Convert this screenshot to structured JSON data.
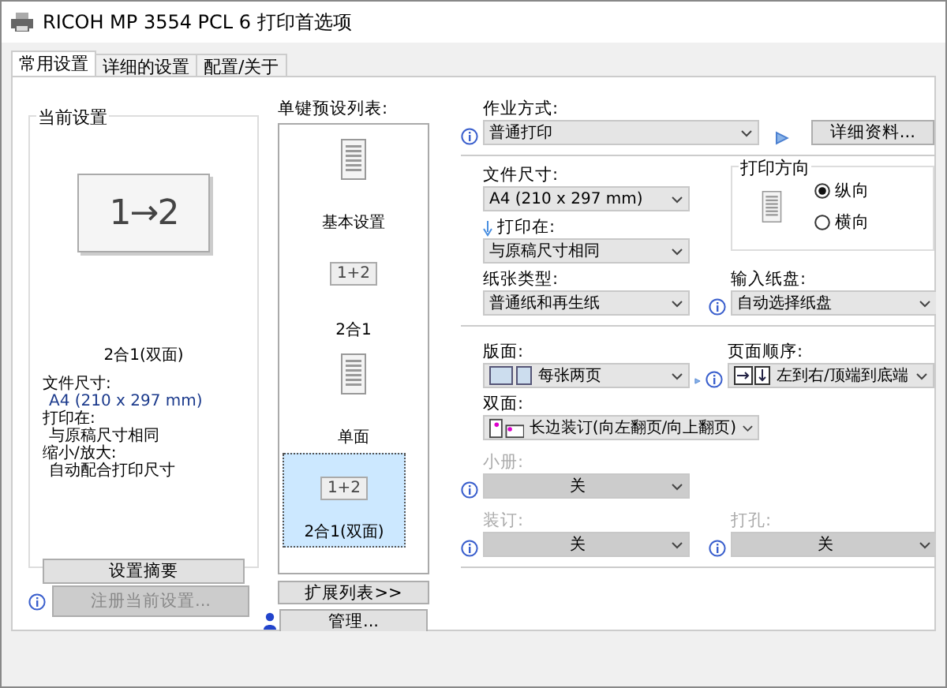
{
  "window": {
    "title": "RICOH MP 3554 PCL 6 打印首选项"
  },
  "tabs": [
    {
      "label": "常用设置",
      "selected": true
    },
    {
      "label": "详细的设置",
      "selected": false
    },
    {
      "label": "配置/关于",
      "selected": false
    }
  ],
  "current_settings": {
    "title": "当前设置",
    "preview_text": "1→2",
    "name": "2合1(双面)",
    "details": [
      {
        "label": "文件尺寸:",
        "value": "A4 (210 x 297 mm)"
      },
      {
        "label": "打印在:",
        "value": "与原稿尺寸相同"
      },
      {
        "label": "缩小/放大:",
        "value": "自动配合打印尺寸"
      }
    ],
    "summary_button": "设置摘要"
  },
  "register_button": {
    "label": "注册当前设置...",
    "disabled": true
  },
  "presets": {
    "title": "单键预设列表:",
    "items": [
      {
        "label": "基本设置",
        "kind": "document",
        "selected": false
      },
      {
        "label": "2合1",
        "kind": "combine",
        "icon_text": "1+2",
        "selected": false
      },
      {
        "label": "单面",
        "kind": "document",
        "selected": false
      },
      {
        "label": "2合1(双面)",
        "kind": "combine",
        "icon_text": "1+2",
        "selected": true
      }
    ],
    "buttons": [
      "扩展列表>>",
      "管理..."
    ]
  },
  "job_mode": {
    "label": "作业方式:",
    "value": "普通打印",
    "details_button": "详细资料..."
  },
  "paper_size": {
    "label": "文件尺寸:",
    "value": "A4 (210 x 297 mm)"
  },
  "print_on": {
    "label": "打印在:",
    "value": "与原稿尺寸相同"
  },
  "orientation": {
    "title": "打印方向",
    "options": [
      {
        "label": "纵向",
        "selected": true
      },
      {
        "label": "横向",
        "selected": false
      }
    ]
  },
  "paper_type": {
    "label": "纸张类型:",
    "value": "普通纸和再生纸"
  },
  "input_tray": {
    "label": "输入纸盘:",
    "value": "自动选择纸盘"
  },
  "layout": {
    "label": "版面:",
    "value": "每张两页"
  },
  "page_order": {
    "label": "页面顺序:",
    "value": "左到右/顶端到底端"
  },
  "duplex": {
    "label": "双面:",
    "value": "长边装订(向左翻页/向上翻页)"
  },
  "booklet": {
    "label": "小册:",
    "value": "关",
    "disabled": true
  },
  "staple": {
    "label": "装订:",
    "value": "关",
    "disabled": true
  },
  "punch": {
    "label": "打孔:",
    "value": "关",
    "disabled": true
  }
}
